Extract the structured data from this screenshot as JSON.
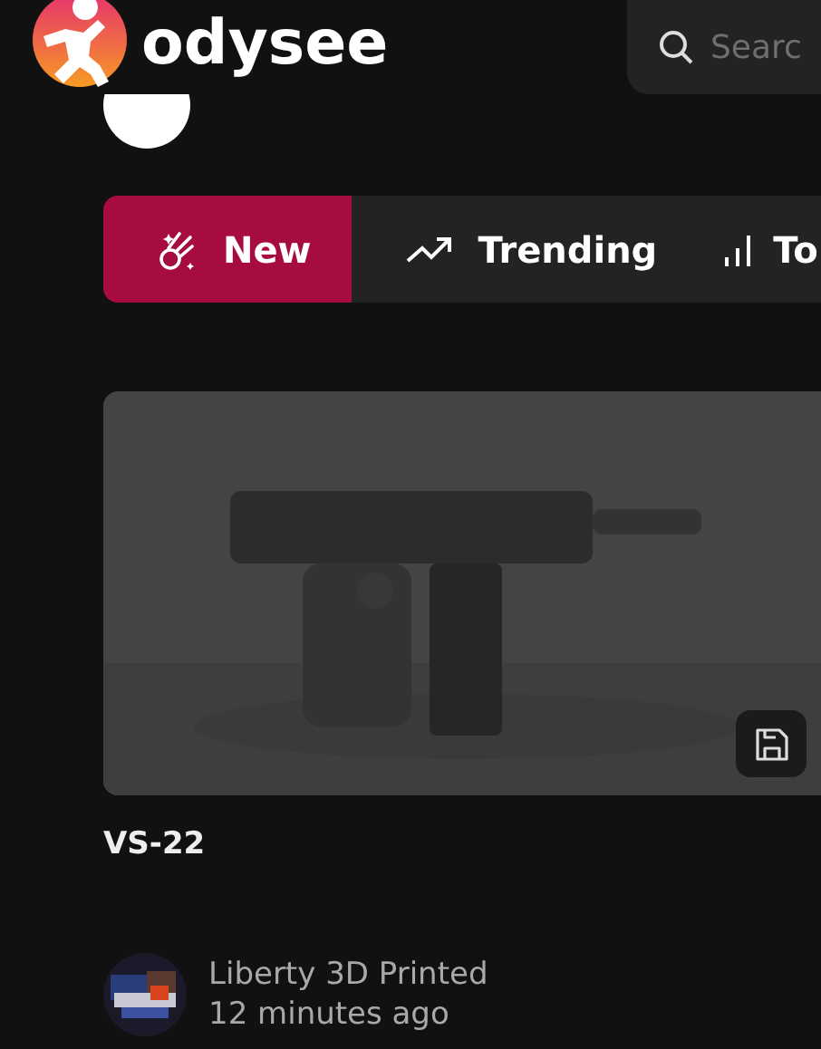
{
  "header": {
    "logo": "odysee",
    "search": {
      "placeholder": "Searc"
    }
  },
  "tabs": [
    {
      "label": "New",
      "kind": "new",
      "selected": true
    },
    {
      "label": "Trending",
      "kind": "trending",
      "selected": false
    },
    {
      "label": "To",
      "kind": "top",
      "selected": false
    }
  ],
  "video": {
    "title": "VS-22",
    "channel": "Liberty 3D Printed",
    "time": "12 minutes ago"
  }
}
